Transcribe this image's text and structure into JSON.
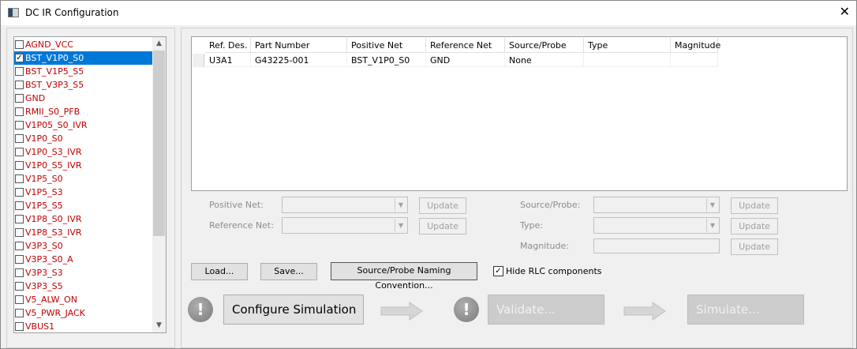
{
  "window": {
    "title": "DC IR Configuration",
    "close_icon": "close-icon"
  },
  "nets": [
    {
      "label": "AGND_VCC",
      "checked": false
    },
    {
      "label": "BST_V1P0_S0",
      "checked": true,
      "selected": true
    },
    {
      "label": "BST_V1P5_S5",
      "checked": false
    },
    {
      "label": "BST_V3P3_S5",
      "checked": false
    },
    {
      "label": "GND",
      "checked": false
    },
    {
      "label": "RMII_S0_PFB",
      "checked": false
    },
    {
      "label": "V1P05_S0_IVR",
      "checked": false
    },
    {
      "label": "V1P0_S0",
      "checked": false
    },
    {
      "label": "V1P0_S3_IVR",
      "checked": false
    },
    {
      "label": "V1P0_S5_IVR",
      "checked": false
    },
    {
      "label": "V1P5_S0",
      "checked": false
    },
    {
      "label": "V1P5_S3",
      "checked": false
    },
    {
      "label": "V1P5_S5",
      "checked": false
    },
    {
      "label": "V1P8_S0_IVR",
      "checked": false
    },
    {
      "label": "V1P8_S3_IVR",
      "checked": false
    },
    {
      "label": "V3P3_S0",
      "checked": false
    },
    {
      "label": "V3P3_S0_A",
      "checked": false
    },
    {
      "label": "V3P3_S3",
      "checked": false
    },
    {
      "label": "V3P3_S5",
      "checked": false
    },
    {
      "label": "V5_ALW_ON",
      "checked": false
    },
    {
      "label": "V5_PWR_JACK",
      "checked": false
    },
    {
      "label": "VBUS1",
      "checked": false
    }
  ],
  "table": {
    "headers": [
      "Ref. Des.",
      "Part Number",
      "Positive Net",
      "Reference Net",
      "Source/Probe",
      "Type",
      "Magnitude"
    ],
    "rows": [
      [
        "U3A1",
        "G43225-001",
        "BST_V1P0_S0",
        "GND",
        "None",
        "",
        ""
      ]
    ]
  },
  "form": {
    "positive_net_label": "Positive Net:",
    "reference_net_label": "Reference Net:",
    "source_probe_label": "Source/Probe:",
    "type_label": "Type:",
    "magnitude_label": "Magnitude:",
    "update_label": "Update"
  },
  "buttons": {
    "load": "Load...",
    "save": "Save...",
    "naming": "Source/Probe Naming Convention...",
    "hide_rlc": "Hide RLC components",
    "hide_rlc_checked": true
  },
  "workflow": {
    "configure": "Configure Simulation",
    "validate": "Validate...",
    "simulate": "Simulate...",
    "warning_glyph": "!"
  }
}
